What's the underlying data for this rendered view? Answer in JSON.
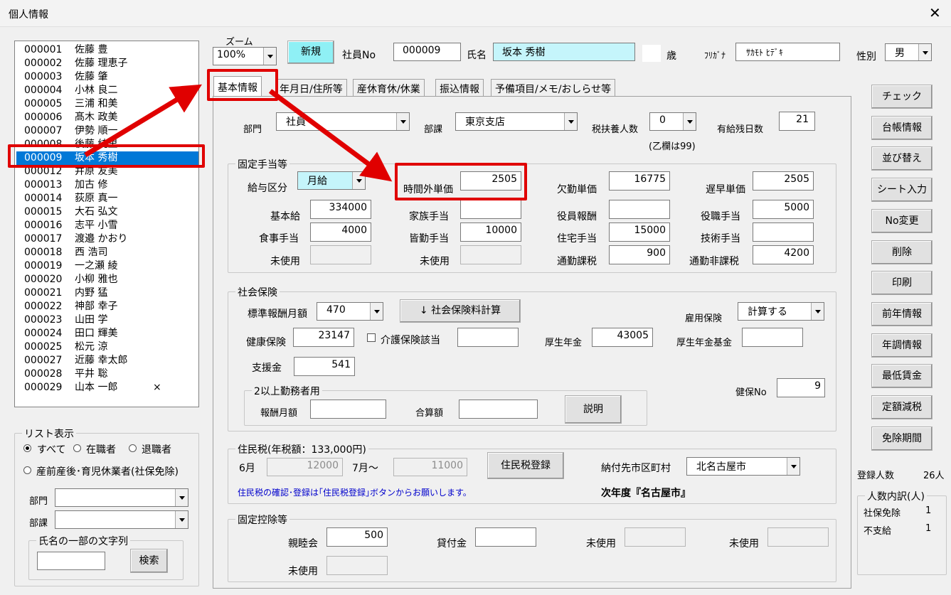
{
  "window": {
    "title": "個人情報"
  },
  "employee_list": [
    {
      "no": "000001",
      "name": "佐藤 豊"
    },
    {
      "no": "000002",
      "name": "佐藤 理恵子"
    },
    {
      "no": "000003",
      "name": "佐藤 肇"
    },
    {
      "no": "000004",
      "name": "小林 良二"
    },
    {
      "no": "000005",
      "name": "三浦 和美"
    },
    {
      "no": "000006",
      "name": "髙木 政美"
    },
    {
      "no": "000007",
      "name": "伊勢 順一"
    },
    {
      "no": "000008",
      "name": "後藤 純里"
    },
    {
      "no": "000009",
      "name": "坂本 秀樹"
    },
    {
      "no": "000012",
      "name": "井原 友美"
    },
    {
      "no": "000013",
      "name": "加古 修"
    },
    {
      "no": "000014",
      "name": "荻原 真一"
    },
    {
      "no": "000015",
      "name": "大石 弘文"
    },
    {
      "no": "000016",
      "name": "志平 小雪"
    },
    {
      "no": "000017",
      "name": "渡邉 かおり"
    },
    {
      "no": "000018",
      "name": "西 浩司"
    },
    {
      "no": "000019",
      "name": "一之瀬 綾"
    },
    {
      "no": "000020",
      "name": "小柳 雅也"
    },
    {
      "no": "000021",
      "name": "内野 猛"
    },
    {
      "no": "000022",
      "name": "神部 幸子"
    },
    {
      "no": "000023",
      "name": "山田 学"
    },
    {
      "no": "000024",
      "name": "田口 輝美"
    },
    {
      "no": "000025",
      "name": "松元 涼"
    },
    {
      "no": "000027",
      "name": "近藤 幸太郎"
    },
    {
      "no": "000028",
      "name": "平井 聡"
    },
    {
      "no": "000029",
      "name": "山本 一郎",
      "mark": "×"
    }
  ],
  "list_display": {
    "title": "リスト表示",
    "opt_all": "すべて",
    "opt_active": "在職者",
    "opt_retired": "退職者",
    "opt_leave": "産前産後･育児休業者(社保免除)",
    "dept_label": "部門",
    "section_label": "部課",
    "name_search_title": "氏名の一部の文字列",
    "search_button": "検索"
  },
  "top": {
    "zoom_label": "ズーム",
    "zoom_value": "100%",
    "new_button": "新規",
    "emp_no_label": "社員No",
    "emp_no_value": "000009",
    "name_label": "氏名",
    "name_value": "坂本 秀樹",
    "age_label": "歳",
    "kana_label": "ﾌﾘｶﾞﾅ",
    "kana_value": "ｻｶﾓﾄ ﾋﾃﾞｷ",
    "sex_label": "性別",
    "sex_value": "男"
  },
  "tabs": [
    "基本情報",
    "年月日/住所等",
    "産休育休/休業",
    "振込情報",
    "予備項目/メモ/おしらせ等"
  ],
  "basic": {
    "dept_label": "部門",
    "dept_value": "社員",
    "section_label": "部課",
    "section_value": "東京支店",
    "dependents_label": "税扶養人数",
    "dependents_value": "0",
    "dependents_note": "(乙欄は99)",
    "paid_leave_label": "有給残日数",
    "paid_leave_value": "21"
  },
  "fixed_allowance": {
    "title": "固定手当等",
    "pay_type_label": "給与区分",
    "pay_type_value": "月給",
    "overtime_label": "時間外単価",
    "overtime_value": "2505",
    "absence_label": "欠勤単価",
    "absence_value": "16775",
    "late_label": "遅早単価",
    "late_value": "2505",
    "base_label": "基本給",
    "base_value": "334000",
    "family_label": "家族手当",
    "family_value": "",
    "officer_label": "役員報酬",
    "officer_value": "",
    "position_label": "役職手当",
    "position_value": "5000",
    "meal_label": "食事手当",
    "meal_value": "4000",
    "attendance_label": "皆勤手当",
    "attendance_value": "10000",
    "housing_label": "住宅手当",
    "housing_value": "15000",
    "skill_label": "技術手当",
    "skill_value": "",
    "unused1_label": "未使用",
    "unused2_label": "未使用",
    "commute_tax_label": "通勤課税",
    "commute_tax_value": "900",
    "commute_free_label": "通勤非課税",
    "commute_free_value": "4200"
  },
  "social_insurance": {
    "title": "社会保険",
    "std_label": "標準報酬月額",
    "std_value": "470",
    "calc_button": "↓ 社会保険料計算",
    "employment_label": "雇用保険",
    "employment_value": "計算する",
    "health_label": "健康保険",
    "health_value": "23147",
    "care_label": "介護保険該当",
    "pension_label": "厚生年金",
    "pension_value": "43005",
    "pension_fund_label": "厚生年金基金",
    "support_label": "支援金",
    "support_value": "541",
    "multi_title": "2以上勤務者用",
    "reward_label": "報酬月額",
    "total_label": "合算額",
    "explain_button": "説明",
    "health_no_label": "健保No",
    "health_no_value": "9"
  },
  "resident_tax": {
    "title": "住民税(年税額：133,000円)",
    "june_label": "6月",
    "june_value": "12000",
    "july_label": "7月～",
    "july_value": "11000",
    "register_button": "住民税登録",
    "city_label": "納付先市区町村",
    "city_value": "北名古屋市",
    "note": "住民税の確認･登録は｢住民税登録｣ボタンからお願いします。",
    "next_year": "次年度『名古屋市』"
  },
  "fixed_deduction": {
    "title": "固定控除等",
    "association_label": "親睦会",
    "association_value": "500",
    "loan_label": "貸付金",
    "loan_value": "",
    "unused1_label": "未使用",
    "unused2_label": "未使用",
    "unused3_label": "未使用"
  },
  "side_buttons": [
    "チェック",
    "台帳情報",
    "並び替え",
    "シート入力",
    "No変更",
    "削除",
    "印刷",
    "前年情報",
    "年調情報",
    "最低賃金",
    "定額減税",
    "免除期間"
  ],
  "summary": {
    "registered_label": "登録人数",
    "registered_value": "26人",
    "breakdown_title": "人数内訳(人)",
    "exempt_label": "社保免除",
    "exempt_value": "1",
    "unpaid_label": "不支給",
    "unpaid_value": "1"
  },
  "colors": {
    "highlight": "#e00000",
    "selection": "#0078d7",
    "name_bg": "#c5f5fb"
  }
}
